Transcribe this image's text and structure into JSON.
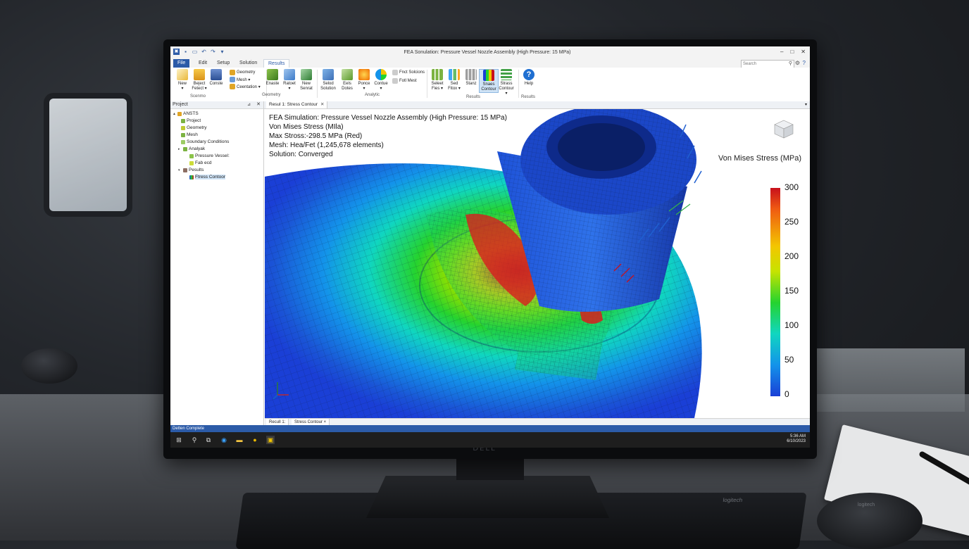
{
  "window": {
    "title": "FEA Sonulation: Pressure Vessel Nozzle Assembly (High Pressure: 15 MPa)"
  },
  "ribbon_tabs": [
    "File",
    "Edit",
    "Setup",
    "Solution",
    "Results"
  ],
  "active_tab": "Results",
  "search": {
    "placeholder": "Search"
  },
  "ribbon": {
    "buttons": [
      {
        "label": "New",
        "sub": "▾"
      },
      {
        "label": "Beject",
        "sub": "Fetect ▾"
      },
      {
        "label": "Conste",
        "sub": ""
      },
      {
        "label": "Enaste",
        "sub": ""
      },
      {
        "label": "Ratoet",
        "sub": "▾"
      },
      {
        "label": "New",
        "sub": "Senrat"
      },
      {
        "label": "Selod",
        "sub": "Solution"
      },
      {
        "label": "Eels",
        "sub": "Dotes"
      },
      {
        "label": "Ponce",
        "sub": "▾"
      },
      {
        "label": "Contue",
        "sub": "▾"
      },
      {
        "label": "Seleet",
        "sub": "Fies ▾"
      },
      {
        "label": "Sed",
        "sub": "Fitox ▾"
      },
      {
        "label": "Stanz",
        "sub": ""
      },
      {
        "label": "Snaes",
        "sub": "Contour"
      },
      {
        "label": "Strass",
        "sub": "Contour ▾"
      },
      {
        "label": "Help",
        "sub": ""
      }
    ],
    "small": [
      "Geometry",
      "Mesh ▾",
      "Ceentation ▾",
      "Fnct Solcions",
      "Fotl Mest"
    ],
    "groups": [
      "Scenmo",
      "Geometry",
      "Analytic",
      "Results",
      "Results"
    ]
  },
  "project": {
    "header": "Project",
    "tree": [
      {
        "label": "ANSTS",
        "depth": 0
      },
      {
        "label": "Project",
        "depth": 1
      },
      {
        "label": "Geometry",
        "depth": 1
      },
      {
        "label": "Mesh",
        "depth": 1
      },
      {
        "label": "Soundary Conditions",
        "depth": 1
      },
      {
        "label": "Analyak",
        "depth": 1
      },
      {
        "label": "Pressure Vessel:",
        "depth": 2
      },
      {
        "label": "Fab ecd",
        "depth": 2
      },
      {
        "label": "Pesults",
        "depth": 1
      },
      {
        "label": "Ftress Contoor",
        "depth": 2
      }
    ]
  },
  "document_tab": "Resul 1: Stress Contour",
  "viewport_info": [
    "FEA Simulation: Pressure Vessel Nozzle Assembly (High Pressure: 15 MPa)",
    "Von Mises Stress (MIla)",
    "Max Stross:-298.5 MPa (Red)",
    "Mesh: Hea/Fet (1,245,678 elements)",
    "Solution: Converged"
  ],
  "legend": {
    "title": "Von Mises Stress (MPa)",
    "ticks": [
      "300",
      "250",
      "200",
      "150",
      "100",
      "50",
      "0"
    ],
    "colors": [
      "#c8101c",
      "#f3c600",
      "#25d32f",
      "#10d6c0",
      "#1a3fd6"
    ]
  },
  "bottom_tabs": [
    "Recull 1:",
    "Stress Contour ×"
  ],
  "status": "Detten Complete",
  "taskbar": {
    "icons": [
      "windows-icon",
      "search-icon",
      "task-view-icon",
      "edge-icon",
      "folder-icon",
      "chrome-icon",
      "app-icon"
    ],
    "time": "5:36 AM",
    "date": "6/10/2023"
  },
  "monitor_brand": "DELL",
  "keyboard_brand": "logitech",
  "mouse_brand": "logitech"
}
